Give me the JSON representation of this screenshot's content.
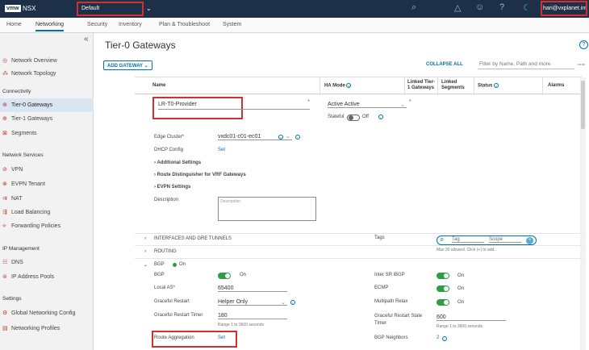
{
  "topbar": {
    "logo": "vmw",
    "app": "NSX",
    "context": "Default",
    "user": "hari@vxplanet.int"
  },
  "nav": {
    "tabs": [
      "Home",
      "Networking",
      "Security",
      "Inventory",
      "Plan & Troubleshoot",
      "System"
    ]
  },
  "sidebar": {
    "items": {
      "overview": "Network Overview",
      "topology": "Network Topology",
      "t0": "Tier-0 Gateways",
      "t1": "Tier-1 Gateways",
      "segments": "Segments",
      "vpn": "VPN",
      "evpn": "EVPN Tenant",
      "nat": "NAT",
      "lb": "Load Balancing",
      "fwd": "Forwarding Policies",
      "dns": "DNS",
      "ipam": "IP Address Pools",
      "gnc": "Global Networking Config",
      "profiles": "Networking Profiles"
    },
    "headers": {
      "connectivity": "Connectivity",
      "services": "Network Services",
      "ipm": "IP Management",
      "settings": "Settings"
    }
  },
  "main": {
    "title": "Tier-0 Gateways",
    "add_gateway": "ADD GATEWAY",
    "collapse_all": "COLLAPSE ALL",
    "filter_placeholder": "Filter by Name, Path and more",
    "columns": {
      "name": "Name",
      "ha": "HA Mode",
      "linked_t1_a": "Linked Tier-",
      "linked_t1_b": "1 Gateways",
      "linked_seg_a": "Linked",
      "linked_seg_b": "Segments",
      "status": "Status",
      "alarms": "Alarms"
    },
    "gateway": {
      "name": "LR-T0-Provider",
      "ha_mode": "Active Active",
      "stateful_label": "Stateful",
      "stateful_value": "Off",
      "edge_cluster_label": "Edge Cluster*",
      "edge_cluster": "vxdc01-c01-ec01",
      "dhcp_label": "DHCP Config",
      "dhcp_value": "Set",
      "additional": "Additional Settings",
      "rd": "Route Distinguisher for VRF Gateways",
      "evpn": "EVPN Settings",
      "description_label": "Description",
      "description_placeholder": "Description",
      "tags_label": "Tags",
      "tag_ph": "Tag",
      "scope_ph": "Scope",
      "tags_hint": "Max 30 allowed. Click (+) to add.",
      "interfaces": "INTERFACES AND GRE TUNNELS",
      "routing": "ROUTING",
      "bgp_section": "BGP",
      "bgp_status": "On",
      "bgp_label": "BGP",
      "bgp_value": "On",
      "local_as_label": "Local AS*",
      "local_as": "65400",
      "graceful_label": "Graceful Restart",
      "graceful": "Helper Only",
      "grt_label": "Graceful Restart Timer",
      "grt": "180",
      "grt_hint": "Range 1 to 3600 seconds",
      "route_agg_label": "Route Aggregation",
      "route_agg": "Set",
      "inter_sr_label": "Inter SR iBGP",
      "inter_sr": "On",
      "ecmp_label": "ECMP",
      "ecmp": "On",
      "multipath_label": "Multipath Relax",
      "multipath": "On",
      "grst_label_a": "Graceful Restart Stale",
      "grst_label_b": "Timer",
      "grst": "600",
      "grst_hint": "Range 1 to 3600 seconds",
      "neighbors_label": "BGP Neighbors",
      "neighbors": "2"
    }
  }
}
